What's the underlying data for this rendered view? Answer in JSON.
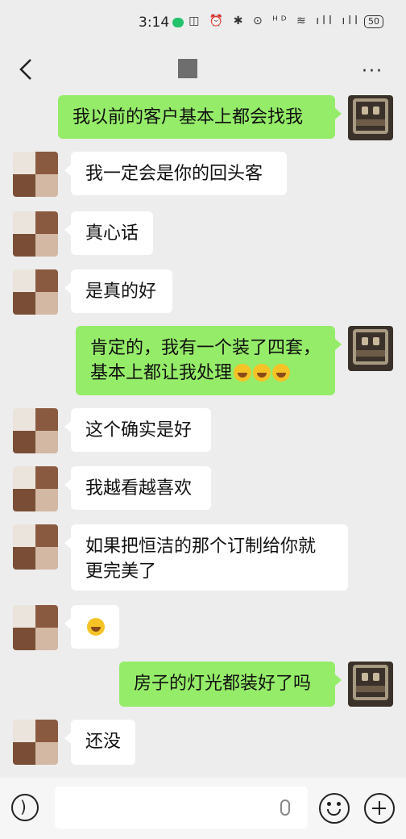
{
  "status_bar": {
    "time": "3:14",
    "icons_text": "◫ ⏰ ✱ ⊙ ᴴᴰ ≋ ıll ıll",
    "battery": "50"
  },
  "title_bar": {
    "back_icon": "chevron-left-icon",
    "more_icon": "ellipsis-icon",
    "more_text": "···"
  },
  "messages": [
    {
      "side": "right",
      "text": "我以前的客户基本上都会找我"
    },
    {
      "side": "left",
      "text": "我一定会是你的回头客"
    },
    {
      "side": "left",
      "text": "真心话"
    },
    {
      "side": "left",
      "text": "是真的好"
    },
    {
      "side": "right",
      "text": "肯定的，我有一个装了四套，\n基本上都让我处理",
      "emoji_count": 3,
      "emoji": "laugh-cry-emoji"
    },
    {
      "side": "left",
      "text": "这个确实是好"
    },
    {
      "side": "left",
      "text": "我越看越喜欢"
    },
    {
      "side": "left",
      "text": "如果把恒洁的那个订制给你就\n更完美了"
    },
    {
      "side": "left",
      "text": "",
      "emoji_count": 1,
      "emoji": "laugh-cry-emoji"
    },
    {
      "side": "right",
      "text": "房子的灯光都装好了吗"
    },
    {
      "side": "left",
      "text": "还没"
    }
  ],
  "input_bar": {
    "placeholder": "",
    "icons": [
      "voice-icon",
      "microphone-icon",
      "emoji-icon",
      "plus-icon"
    ]
  },
  "colors": {
    "background": "#ededed",
    "bubble_right": "#95ec69",
    "bubble_left": "#ffffff",
    "status_chat": "#22c36a"
  }
}
